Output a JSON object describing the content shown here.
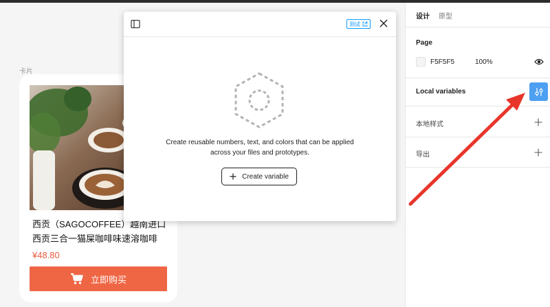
{
  "canvas": {
    "frame_label": "卡片",
    "card": {
      "title": "西贡（SAGOCOFFEE）越南进口西贡三合一猫屎咖啡味速溶咖啡",
      "price": "¥48.80",
      "buy_label": "立即购买"
    }
  },
  "modal": {
    "test_badge": "测试",
    "empty_text": "Create reusable numbers, text, and colors that can be applied across your files and prototypes.",
    "create_label": "Create variable"
  },
  "panel": {
    "tabs": {
      "design": "设计",
      "prototype": "原型"
    },
    "page": {
      "title": "Page",
      "color_hex": "F5F5F5",
      "opacity": "100%"
    },
    "local_variables": "Local variables",
    "local_styles": "本地样式",
    "export": "导出"
  },
  "colors": {
    "accent": "#0d99ff",
    "variables_button": "#4d9ff1",
    "buy_button": "#ef6645",
    "price": "#ea5a3d",
    "annotation_arrow": "#e8352a"
  },
  "icons": [
    "sidebar-toggle-icon",
    "external-link-icon",
    "close-icon",
    "hexagon-empty-icon",
    "plus-icon",
    "eye-icon",
    "sliders-icon",
    "cart-icon"
  ]
}
